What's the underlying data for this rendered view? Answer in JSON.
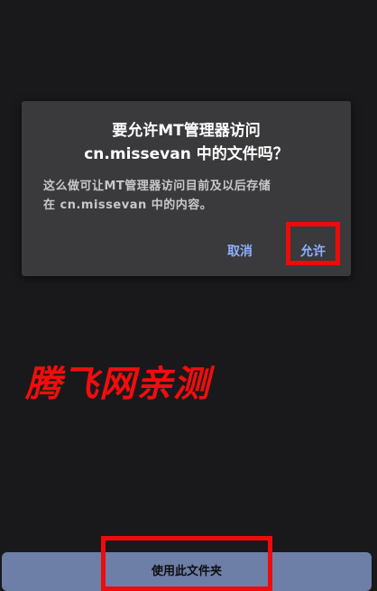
{
  "dialog": {
    "title_line1": "要允许MT管理器访问",
    "title_line2": "cn.missevan 中的文件吗？",
    "body_line1": "这么做可让MT管理器访问目前及以后存储",
    "body_line2": "在 cn.missevan 中的内容。",
    "cancel_label": "取消",
    "allow_label": "允许"
  },
  "watermark": "腾飞网亲测",
  "bottom": {
    "use_folder_label": "使用此文件夹"
  },
  "colors": {
    "background": "#19191b",
    "dialog": "#3a3a3c",
    "accent": "#8fb0ff",
    "highlight": "#ee0b0b",
    "bottom_button": "#6d7fa6"
  }
}
